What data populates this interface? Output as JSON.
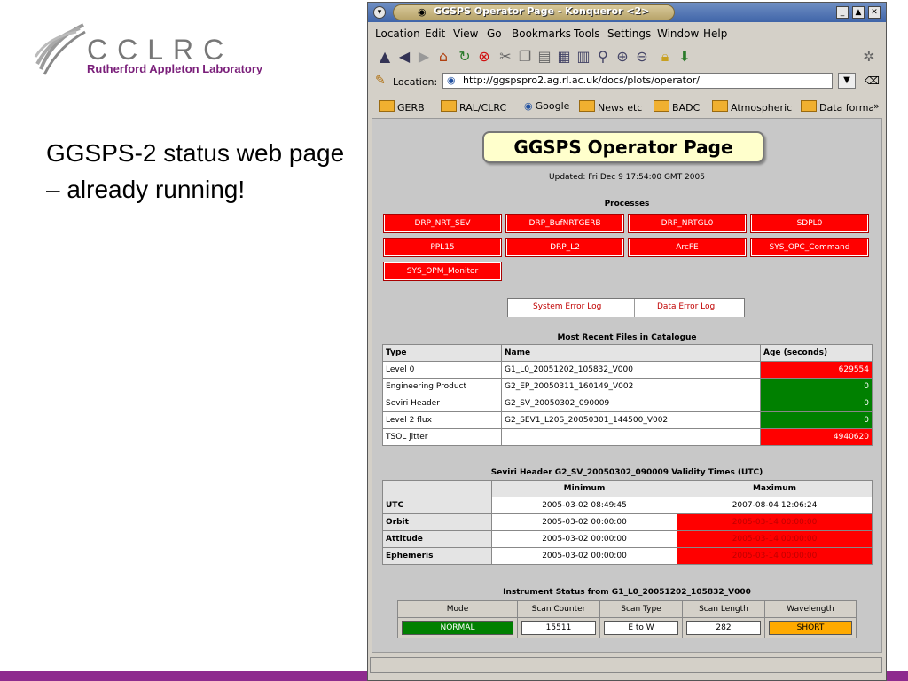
{
  "slide": {
    "logo_name": "CCLRC",
    "logo_sub": "Rutherford Appleton Laboratory",
    "text": "GGSPS-2 status web page – already running!",
    "colors": {
      "accent": "#8e2b8e"
    }
  },
  "browser": {
    "title": "GGSPS Operator Page - Konqueror <2>",
    "menu": [
      "Location",
      "Edit",
      "View",
      "Go",
      "Bookmarks",
      "Tools",
      "Settings",
      "Window",
      "Help"
    ],
    "location_label": "Location:",
    "url": "http://ggspspro2.ag.rl.ac.uk/docs/plots/operator/",
    "bookmarks": [
      "GERB",
      "RAL/CLRC",
      "Google",
      "News etc",
      "BADC",
      "Atmospheric",
      "Data forma"
    ],
    "more": "»"
  },
  "page": {
    "title": "GGSPS Operator Page",
    "updated": "Updated: Fri Dec 9 17:54:00 GMT 2005",
    "processes_title": "Processes",
    "processes": [
      "DRP_NRT_SEV",
      "DRP_BufNRTGERB",
      "DRP_NRTGL0",
      "SDPL0",
      "PPL15",
      "DRP_L2",
      "ArcFE",
      "SYS_OPC_Command",
      "SYS_OPM_Monitor"
    ],
    "error_logs": [
      "System Error Log",
      "Data Error Log"
    ],
    "files_title": "Most Recent Files in Catalogue",
    "files_headers": [
      "Type",
      "Name",
      "Age (seconds)"
    ],
    "files": [
      {
        "type": "Level 0",
        "name": "G1_L0_20051202_105832_V000",
        "age": "629554",
        "status": "red"
      },
      {
        "type": "Engineering Product",
        "name": "G2_EP_20050311_160149_V002",
        "age": "0",
        "status": "green"
      },
      {
        "type": "Seviri Header",
        "name": "G2_SV_20050302_090009",
        "age": "0",
        "status": "green"
      },
      {
        "type": "Level 2 flux",
        "name": "G2_SEV1_L20S_20050301_144500_V002",
        "age": "0",
        "status": "green"
      },
      {
        "type": "TSOL jitter",
        "name": "",
        "age": "4940620",
        "status": "red"
      }
    ],
    "validity_title": "Seviri Header G2_SV_20050302_090009 Validity Times (UTC)",
    "validity_headers": [
      "",
      "Minimum",
      "Maximum"
    ],
    "validity": [
      {
        "label": "UTC",
        "min": "2005-03-02 08:49:45",
        "max": "2007-08-04 12:06:24",
        "max_status": "ok"
      },
      {
        "label": "Orbit",
        "min": "2005-03-02 00:00:00",
        "max": "2005-03-14 00:00:00",
        "max_status": "red"
      },
      {
        "label": "Attitude",
        "min": "2005-03-02 00:00:00",
        "max": "2005-03-14 00:00:00",
        "max_status": "red"
      },
      {
        "label": "Ephemeris",
        "min": "2005-03-02 00:00:00",
        "max": "2005-03-14 00:00:00",
        "max_status": "red"
      }
    ],
    "instrument_title": "Instrument Status from G1_L0_20051202_105832_V000",
    "instrument_headers": [
      "Mode",
      "Scan Counter",
      "Scan Type",
      "Scan Length",
      "Wavelength"
    ],
    "instrument_values": [
      "NORMAL",
      "15511",
      "E to W",
      "282",
      "SHORT"
    ],
    "colors": {
      "ok": "#008000",
      "alarm": "#ff0000",
      "warn": "#ffaa00"
    }
  }
}
